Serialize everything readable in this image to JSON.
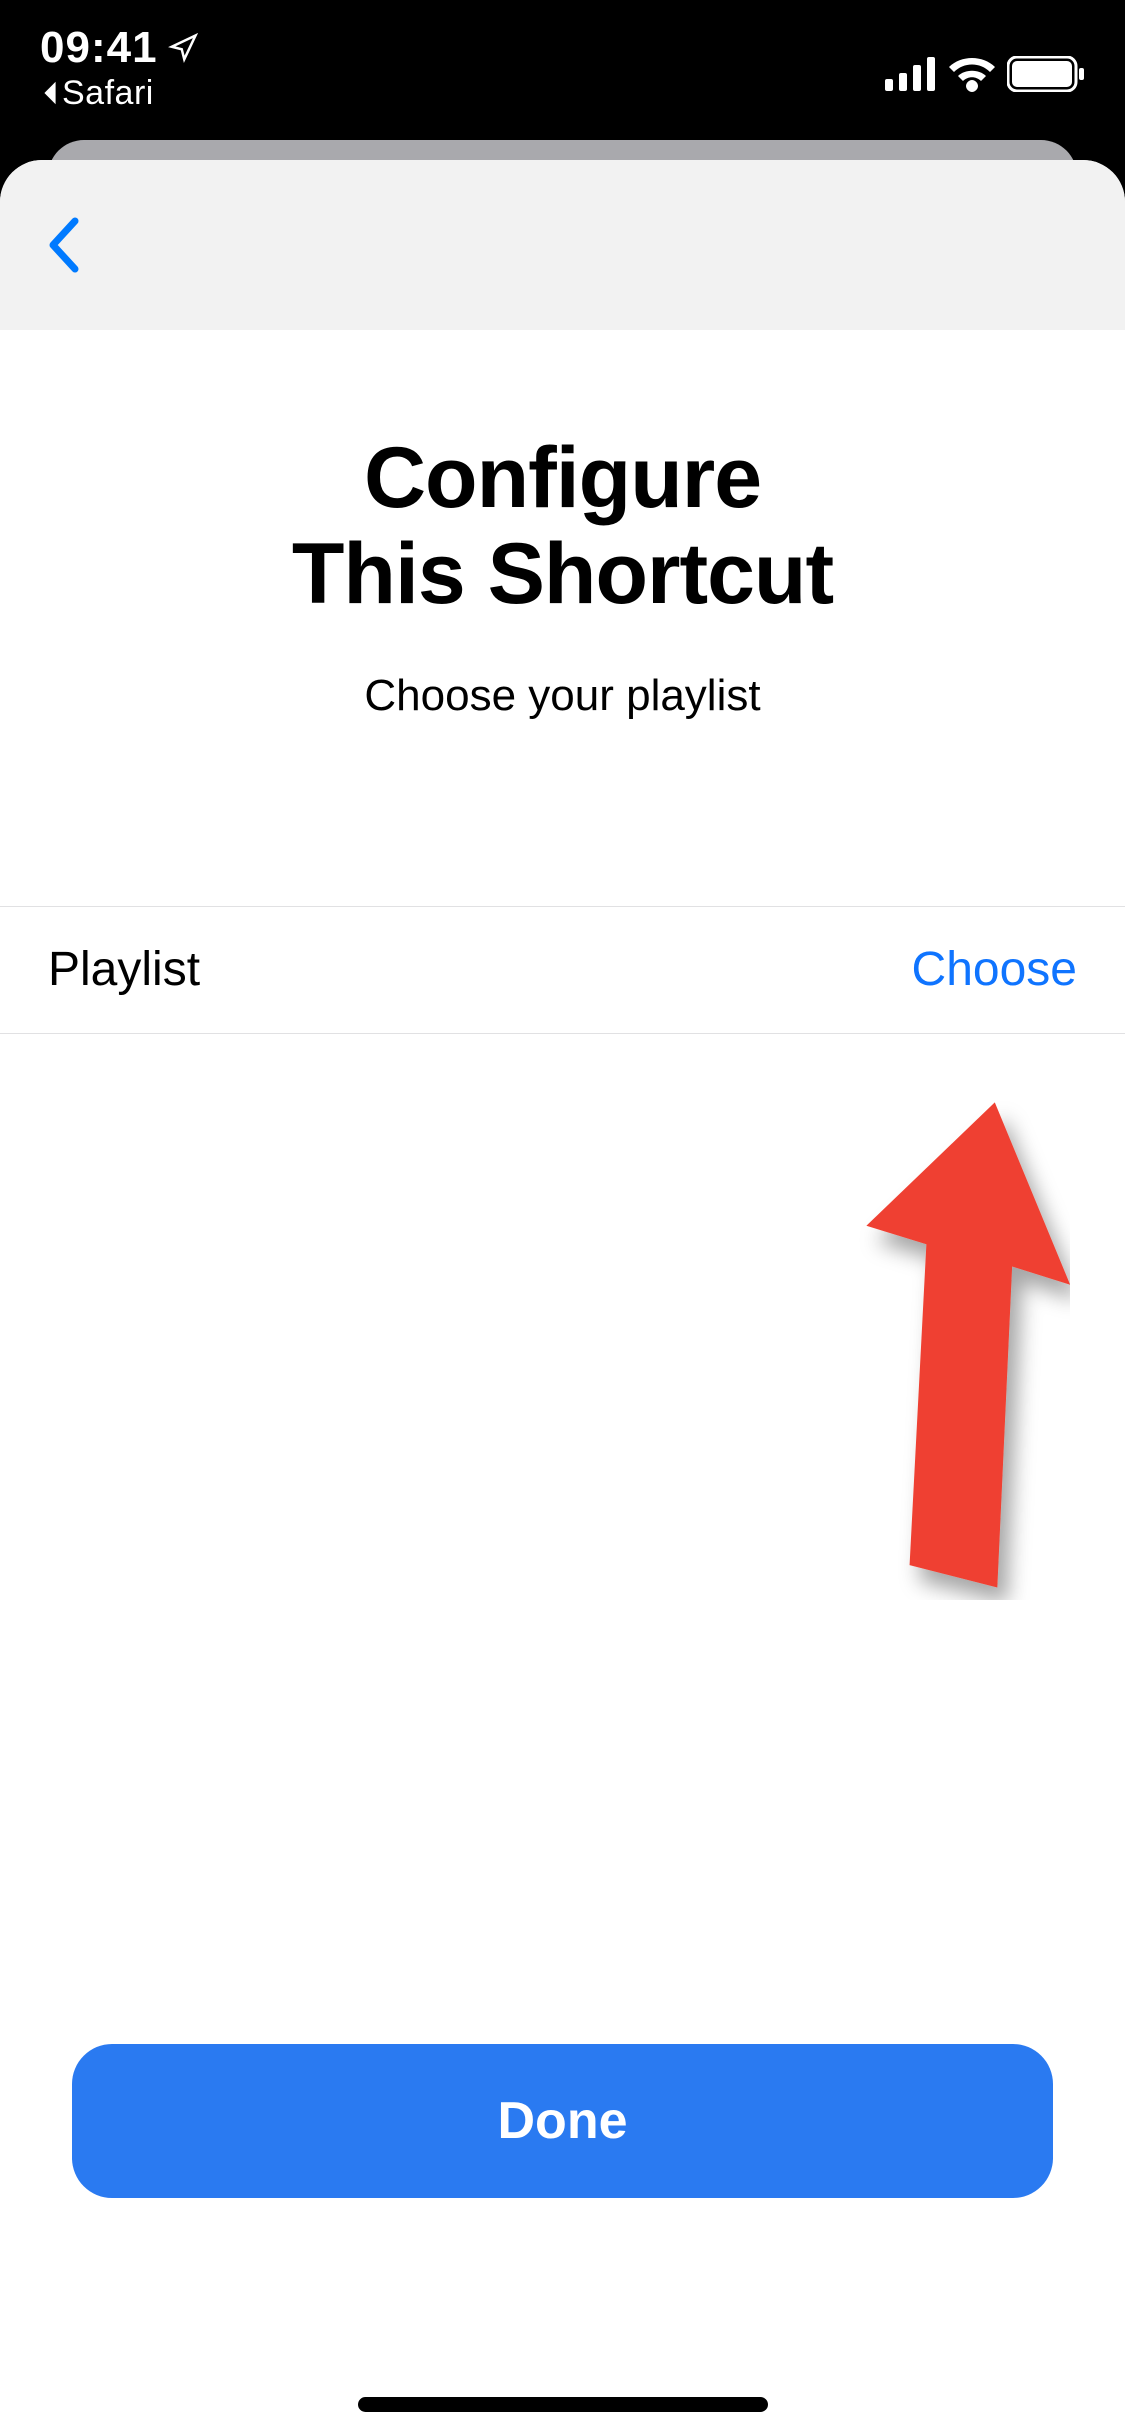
{
  "status": {
    "time": "09:41",
    "back_app": "Safari"
  },
  "nav": {},
  "page": {
    "title_line1": "Configure",
    "title_line2": "This Shortcut",
    "subtitle": "Choose your playlist"
  },
  "row": {
    "label": "Playlist",
    "action": "Choose"
  },
  "buttons": {
    "done": "Done"
  },
  "colors": {
    "accent": "#2a7af1",
    "link": "#0f74ff",
    "annotation_arrow": "#ef4131"
  }
}
